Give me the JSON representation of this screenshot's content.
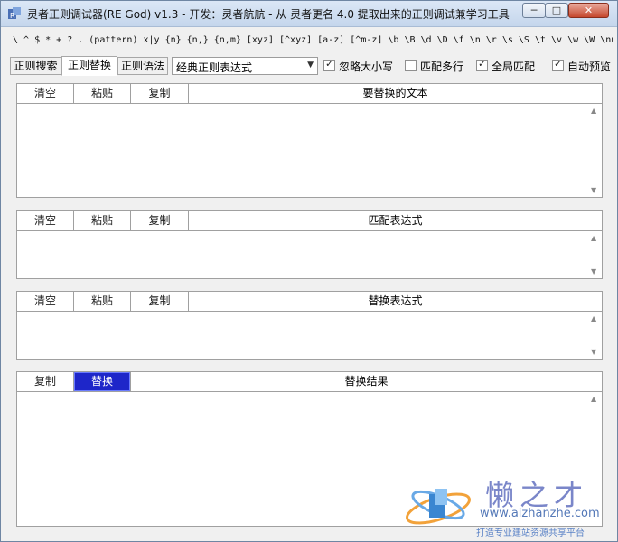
{
  "window": {
    "title": "灵者正则调试器(RE God) v1.3 - 开发：灵者航航 - 从 灵者更名 4.0 提取出来的正则调试兼学习工具",
    "min_label": "─",
    "max_label": "□",
    "close_label": "✕"
  },
  "syntax_hint": "\\ ^ $ * + ? . (pattern) x|y {n} {n,} {n,m} [xyz] [^xyz] [a-z] [^m-z] \\b \\B \\d \\D \\f \\n \\r \\s \\S \\t \\v \\w \\W \\num \\n",
  "tabs": [
    {
      "label": "正则搜索",
      "active": false
    },
    {
      "label": "正则替换",
      "active": true
    },
    {
      "label": "正则语法",
      "active": false
    }
  ],
  "preset_select": {
    "value": "经典正则表达式"
  },
  "options": [
    {
      "label": "忽略大小写",
      "checked": true
    },
    {
      "label": "匹配多行",
      "checked": false
    },
    {
      "label": "全局匹配",
      "checked": true
    },
    {
      "label": "自动预览",
      "checked": true
    }
  ],
  "panels": {
    "source": {
      "clear": "清空",
      "paste": "粘贴",
      "copy": "复制",
      "title": "要替换的文本"
    },
    "pattern": {
      "clear": "清空",
      "paste": "粘贴",
      "copy": "复制",
      "title": "匹配表达式"
    },
    "replacement": {
      "clear": "清空",
      "paste": "粘贴",
      "copy": "复制",
      "title": "替换表达式"
    },
    "result": {
      "copy": "复制",
      "replace": "替换",
      "title": "替换结果"
    }
  },
  "watermark": {
    "brand": "懒之才",
    "url": "www.aizhanzhe.com",
    "tagline": "打造专业建站资源共享平台"
  },
  "colors": {
    "accent": "#1e26c9",
    "title_bar": "#c5d6ec",
    "close": "#c5472d"
  }
}
